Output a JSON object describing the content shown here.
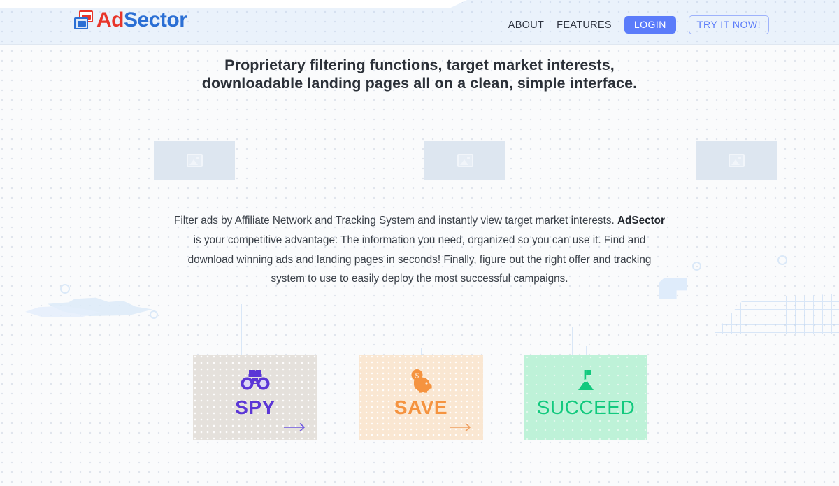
{
  "header": {
    "logo": {
      "icon": "dual-window-icon",
      "text_primary": "Ad",
      "text_secondary": "Sector"
    },
    "nav": [
      {
        "label": "ABOUT",
        "name": "nav-about"
      },
      {
        "label": "FEATURES",
        "name": "nav-features"
      }
    ],
    "login_label": "LOGIN",
    "try_label": "TRY IT NOW!",
    "colors": {
      "login_bg": "#5b7cfa",
      "try_border": "#9eb2fb",
      "bar_bg": "#eaf2fb"
    }
  },
  "hero": {
    "headline_line1": "Proprietary filtering functions, target market interests,",
    "headline_line2": "downloadable landing pages all on a clean, simple interface."
  },
  "placeholders": [
    {
      "name": "image-placeholder-1",
      "alt": "broken-image-icon"
    },
    {
      "name": "image-placeholder-2",
      "alt": "broken-image-icon"
    },
    {
      "name": "image-placeholder-3",
      "alt": "broken-image-icon"
    }
  ],
  "body": {
    "line1": "Filter ads by Affiliate Network and Tracking System and instantly view target market interests.",
    "brand": "AdSector",
    "line2": " is your competitive advantage: The information you need, organized so you can use it. Find and download winning ads and landing pages in seconds! Finally, figure out the right offer and tracking system to use to easily deploy the most successful campaigns."
  },
  "cards": [
    {
      "name": "card-spy",
      "label": "SPY",
      "icon": "binoculars-icon",
      "bg": "#e5e1dc",
      "accent": "#5b36d6",
      "has_arrow": true
    },
    {
      "name": "card-save",
      "label": "SAVE",
      "icon": "piggy-bank-icon",
      "bg": "#fae7d2",
      "accent": "#f5933f",
      "has_arrow": true
    },
    {
      "name": "card-succeed",
      "label": "SUCCEED",
      "icon": "summit-flag-icon",
      "bg": "#bef2d8",
      "accent": "#12c97e",
      "has_arrow": false
    }
  ]
}
